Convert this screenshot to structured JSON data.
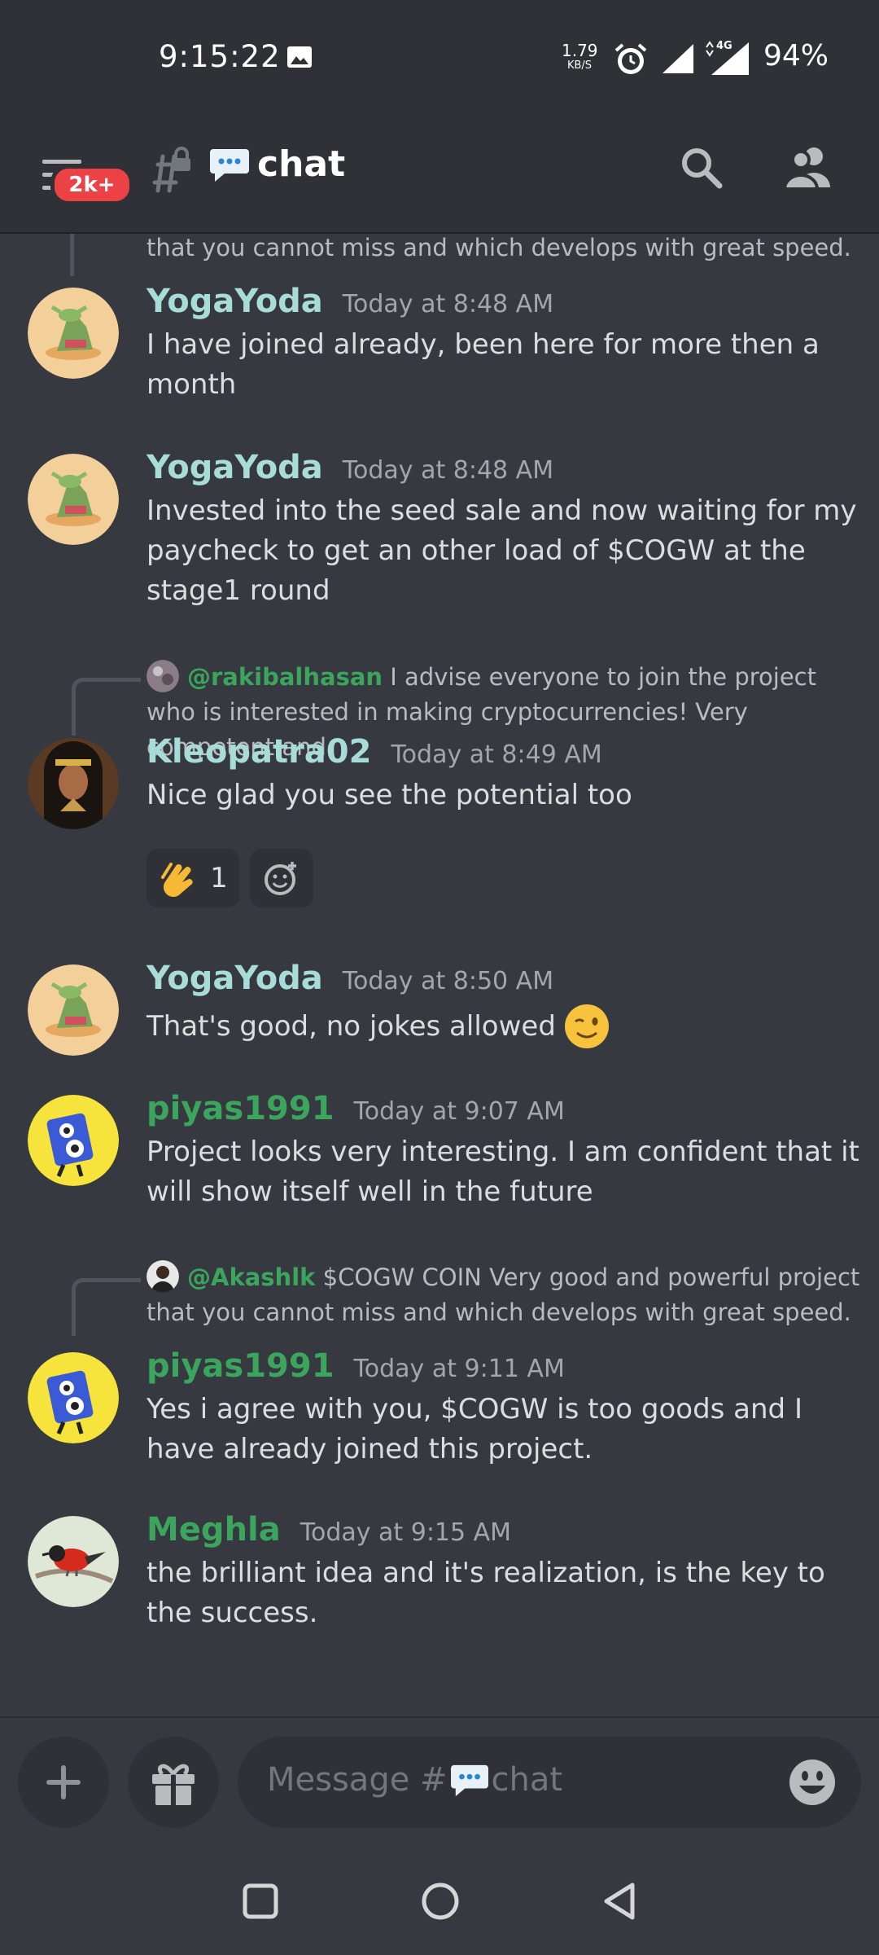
{
  "status_bar": {
    "time": "9:15:22",
    "net_speed": "1.79",
    "net_unit": "KB/S",
    "network": "4G",
    "battery": "94%"
  },
  "header": {
    "unread_badge": "2k+",
    "channel_name": "chat",
    "icons": [
      "menu-icon",
      "locked-channel-icon",
      "speech-balloon-icon",
      "search-icon",
      "members-icon"
    ]
  },
  "messages": [
    {
      "reply_tail": "that you cannot miss and which develops with great speed."
    },
    {
      "author": "YogaYoda",
      "timestamp": "Today at 8:48 AM",
      "text": "I have joined already, been here for more then a month"
    },
    {
      "author": "YogaYoda",
      "timestamp": "Today at 8:48 AM",
      "text": "Invested into the seed sale and now waiting for my paycheck to get an other load of $COGW at the stage1 round"
    },
    {
      "reply_mention": "@rakibalhasan",
      "reply_text": "I advise everyone to join the project who is interested in making cryptocurrencies! Very competent and",
      "author": "Kleopatra02",
      "timestamp": "Today at 8:49 AM",
      "text": "Nice glad you see the potential too",
      "reaction_emoji": "clapping-hands",
      "reaction_count": "1"
    },
    {
      "author": "YogaYoda",
      "timestamp": "Today at 8:50 AM",
      "text": "That's good, no jokes allowed"
    },
    {
      "author": "piyas1991",
      "timestamp": "Today at 9:07 AM",
      "text": "Project looks very interesting. I am confident that it will show itself well in the future"
    },
    {
      "reply_mention": "@Akashlk",
      "reply_text": "$COGW COIN Very good and powerful project that you cannot miss and which develops with great speed.",
      "author": "piyas1991",
      "timestamp": "Today at 9:11 AM",
      "text": "Yes i agree with you, $COGW is too goods and I have already joined this project."
    },
    {
      "author": "Meghla",
      "timestamp": "Today at 9:15 AM",
      "text": "the brilliant idea and it's realization, is the key to the success."
    }
  ],
  "composer": {
    "placeholder_prefix": "Message #",
    "placeholder_channel": "chat"
  },
  "colors": {
    "background": "#36393f",
    "header": "#2f3136",
    "yogayoda_name": "#a8dcd9",
    "green_name": "#3ba55d",
    "badge": "#ed4245"
  }
}
